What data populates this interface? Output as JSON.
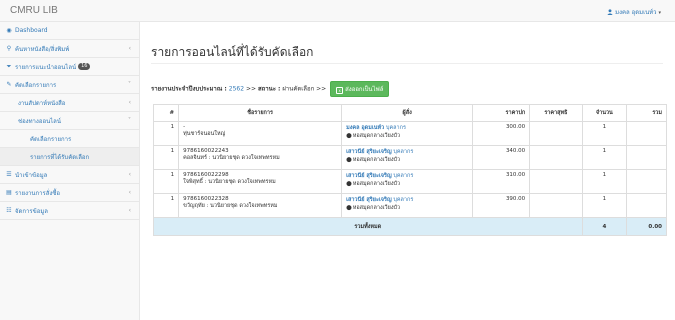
{
  "app": {
    "title": "CMRU LIB"
  },
  "user": {
    "name": "มงคล อุดมเนท์ว"
  },
  "sidebar": {
    "items": [
      {
        "icon": "dashboard-icon",
        "glyph": "◉",
        "label": "Dashboard"
      },
      {
        "icon": "search-icon",
        "glyph": "⚲",
        "label": "ค้นหาหนังสือ/สิ่งพิมพ์"
      },
      {
        "icon": "filter-icon",
        "glyph": "⏷",
        "label": "รายการแนะนำออนไลน์",
        "badge": "16"
      },
      {
        "icon": "edit-icon",
        "glyph": "✎",
        "label": "คัดเลือกรายการ"
      },
      {
        "label": "งานสัปดาห์หนังสือ"
      },
      {
        "label": "ช่องทางออนไลน์"
      },
      {
        "label": "คัดเลือกรายการ"
      },
      {
        "label": "รายการที่ได้รับคัดเลือก"
      },
      {
        "icon": "list-icon",
        "glyph": "☰",
        "label": "นำเข้าข้อมูล"
      },
      {
        "icon": "chart-icon",
        "glyph": "▤",
        "label": "รายงานการสั่งซื้อ"
      },
      {
        "icon": "settings-icon",
        "glyph": "☷",
        "label": "จัดการข้อมูล"
      }
    ]
  },
  "main": {
    "title": "รายการออนไลน์ที่ได้รับคัดเลือก",
    "filter_label": "รายงานประจำปีงบประมาณ :",
    "filter_year": "2562",
    "filter_sep1": ">>",
    "filter_status_label": "สถานะ :",
    "filter_status": "ผ่านคัดเลือก",
    "filter_sep2": ">>",
    "export_label": "ส่งออกเป็นไฟล์",
    "columns": [
      "#",
      "ชื่อรายการ",
      "ผู้สั่ง",
      "ราคาปก",
      "ราคาสุทธิ",
      "จำนวน",
      "รวม"
    ],
    "rows": [
      {
        "num": "1",
        "isbn": "-",
        "title": "ทุ่นชาร์จนอนใหญ่",
        "orderer": "มงคล อุดมเนท์ว",
        "role": "บุคลากร",
        "location": "หอสมุดกลางเวียงบัว",
        "price": "300.00",
        "net": "",
        "qty": "1",
        "sum": ""
      },
      {
        "num": "1",
        "isbn": "9786160022243",
        "title": "คอลจินทร์ : นวนิยายชุด ดวงใจเทพทรหม",
        "orderer": "เสาวนีย์ สุริยะเจริญ",
        "role": "บุคลากร",
        "location": "หอสมุดกลางเวียงบัว",
        "price": "340.00",
        "net": "",
        "qty": "1",
        "sum": ""
      },
      {
        "num": "1",
        "isbn": "9786160022298",
        "title": "ใจพิสุทธิ์ : นวนิยายชุด ดวงใจเทพทรหม",
        "orderer": "เสาวนีย์ สุริยะเจริญ",
        "role": "บุคลากร",
        "location": "หอสมุดกลางเวียงบัว",
        "price": "310.00",
        "net": "",
        "qty": "1",
        "sum": ""
      },
      {
        "num": "1",
        "isbn": "9786160022328",
        "title": "ขวัญฤทัย : นวนิยายชุด ดวงใจเทพทรหม",
        "orderer": "เสาวนีย์ สุริยะเจริญ",
        "role": "บุคลากร",
        "location": "หอสมุดกลางเวียงบัว",
        "price": "390.00",
        "net": "",
        "qty": "1",
        "sum": ""
      }
    ],
    "total": {
      "label": "รวมทั้งหมด",
      "qty": "4",
      "sum": "0.00"
    }
  },
  "colors": {
    "link": "#337ab7",
    "export_button": "#5cb85c",
    "total_row": "#d9edf7"
  }
}
